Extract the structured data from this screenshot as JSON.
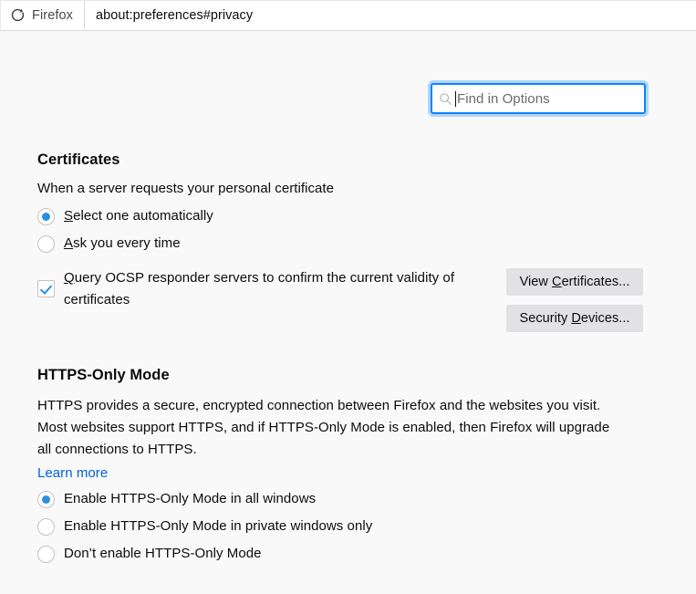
{
  "browser": {
    "tab_label": "Firefox",
    "favicon_name": "firefox-logo-icon",
    "url": "about:preferences#privacy"
  },
  "search": {
    "placeholder": "Find in Options",
    "value": "",
    "icon_name": "search-icon",
    "focus_color": "#0a84ff"
  },
  "sections": {
    "certificates": {
      "title": "Certificates",
      "description": "When a server requests your personal certificate",
      "radios": [
        {
          "label": "Select one automatically",
          "accesskey": "S",
          "checked": true
        },
        {
          "label": "Ask you every time",
          "accesskey": "A",
          "checked": false
        }
      ],
      "checkbox": {
        "label": "Query OCSP responder servers to confirm the current validity of certificates",
        "accesskey": "Q",
        "checked": true
      },
      "buttons": [
        {
          "label": "View Certificates...",
          "accesskey": "C"
        },
        {
          "label": "Security Devices...",
          "accesskey": "D"
        }
      ]
    },
    "https_only": {
      "title": "HTTPS-Only Mode",
      "description": "HTTPS provides a secure, encrypted connection between Firefox and the websites you visit. Most websites support HTTPS, and if HTTPS-Only Mode is enabled, then Firefox will upgrade all connections to HTTPS.",
      "learn_more": "Learn more",
      "radios": [
        {
          "label": "Enable HTTPS-Only Mode in all windows",
          "checked": true
        },
        {
          "label": "Enable HTTPS-Only Mode in private windows only",
          "checked": false
        },
        {
          "label": "Don’t enable HTTPS-Only Mode",
          "checked": false
        }
      ]
    }
  },
  "colors": {
    "accent_blue": "#2b8fe0",
    "link_blue": "#0060df",
    "page_background": "#f9f9fa",
    "button_background": "#e2e2e4"
  }
}
